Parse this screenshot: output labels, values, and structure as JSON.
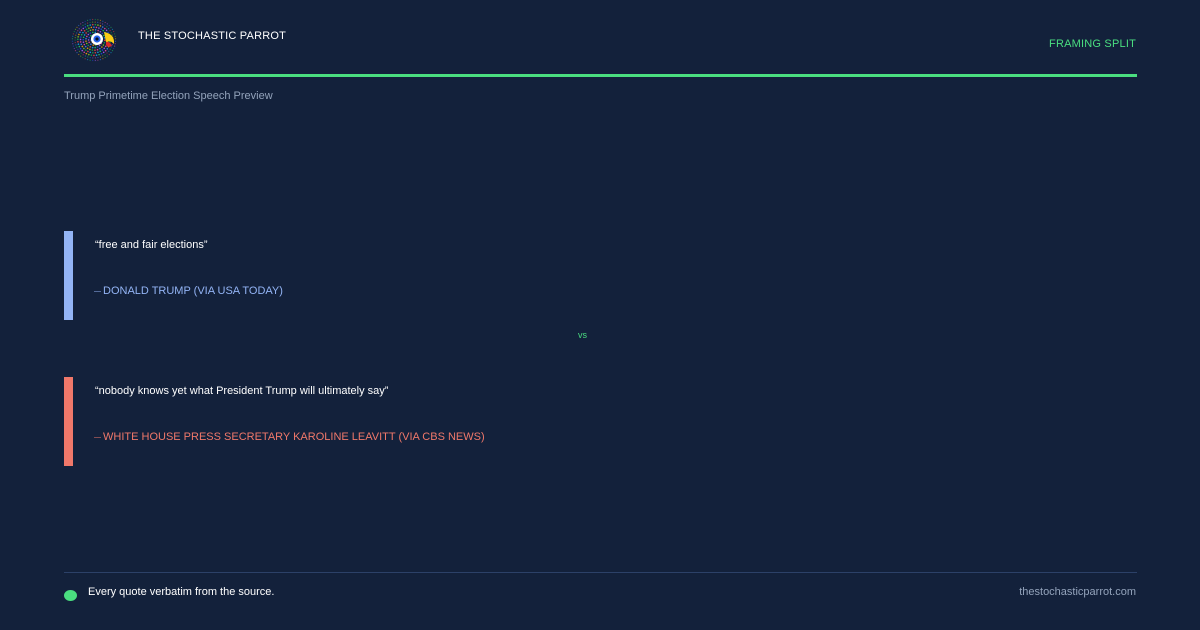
{
  "header": {
    "brand": "THE STOCHASTIC PARROT",
    "tag": "FRAMING SPLIT",
    "subtitle": "Trump Primetime Election Speech Preview"
  },
  "logo": {
    "icon": "parrot-logo-icon"
  },
  "quotes": [
    {
      "text": "“free and fair elections”",
      "dash": "—",
      "attribution": "DONALD TRUMP (VIA USA TODAY)",
      "color": "#93b4f5"
    },
    {
      "text": "“nobody knows yet what President Trump will ultimately say”",
      "dash": "—",
      "attribution": "WHITE HOUSE PRESS SECRETARY KAROLINE LEAVITT (VIA CBS NEWS)",
      "color": "#f0786a"
    }
  ],
  "divider": {
    "label": "vs"
  },
  "footer": {
    "note": "Every quote verbatim from the source.",
    "site": "thestochasticparrot.com"
  },
  "colors": {
    "background": "#13213b",
    "accent": "#4ade80",
    "muted": "#93a3bb"
  }
}
